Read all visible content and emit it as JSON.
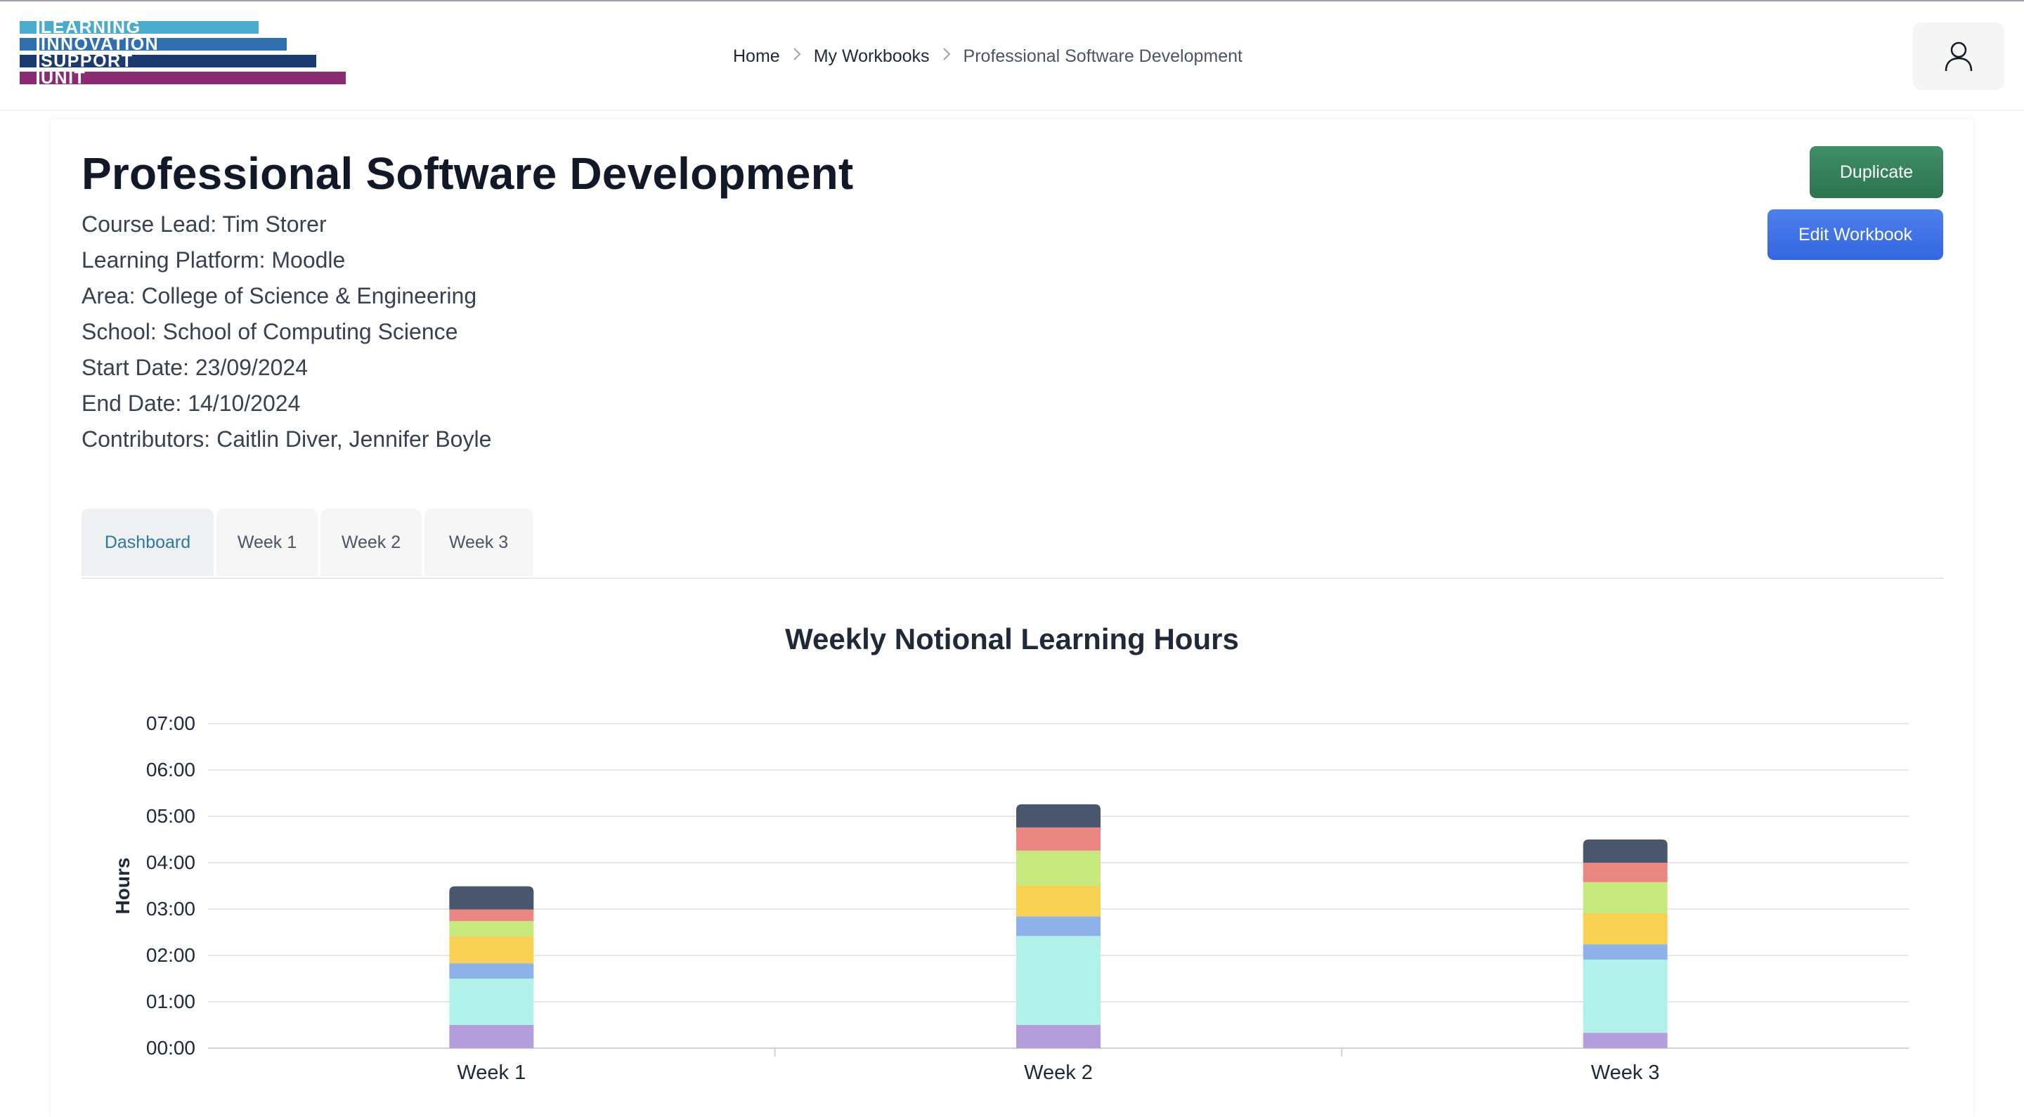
{
  "logo": {
    "lines": [
      "LEARNING",
      "INNOVATION",
      "SUPPORT",
      "UNIT"
    ],
    "colors": [
      "#4aaccc",
      "#2f6fb0",
      "#1c3a6e",
      "#8c2a72"
    ]
  },
  "breadcrumb": {
    "home": "Home",
    "workbooks": "My Workbooks",
    "current": "Professional Software Development"
  },
  "user_menu": {
    "icon": "user-icon"
  },
  "workbook": {
    "title": "Professional Software Development",
    "course_lead": "Course Lead: Tim Storer",
    "learning_platform": "Learning Platform: Moodle",
    "area": "Area: College of Science & Engineering",
    "school": "School: School of Computing Science",
    "start_date": "Start Date: 23/09/2024",
    "end_date": "End Date: 14/10/2024",
    "contributors": "Contributors: Caitlin Diver, Jennifer Boyle"
  },
  "actions": {
    "duplicate": "Duplicate",
    "edit": "Edit Workbook"
  },
  "tabs": [
    {
      "label": "Dashboard",
      "active": true
    },
    {
      "label": "Week 1",
      "active": false
    },
    {
      "label": "Week 2",
      "active": false
    },
    {
      "label": "Week 3",
      "active": false
    }
  ],
  "chart_data": {
    "type": "bar",
    "stacked": true,
    "title": "Weekly Notional Learning Hours",
    "xlabel": "",
    "ylabel": "Hours",
    "categories": [
      "Week 1",
      "Week 2",
      "Week 3"
    ],
    "ylim": [
      0,
      7
    ],
    "yticks": [
      "00:00",
      "01:00",
      "02:00",
      "03:00",
      "04:00",
      "05:00",
      "06:00",
      "07:00"
    ],
    "grid": true,
    "series": [
      {
        "color": "#b39ddb",
        "values": [
          0.5,
          0.5,
          0.33
        ]
      },
      {
        "color": "#b2f1ea",
        "values": [
          1.0,
          1.92,
          1.58
        ]
      },
      {
        "color": "#8fb1e9",
        "values": [
          0.33,
          0.42,
          0.33
        ]
      },
      {
        "color": "#f7d154",
        "values": [
          0.58,
          0.67,
          0.67
        ]
      },
      {
        "color": "#c7e77f",
        "values": [
          0.33,
          0.75,
          0.67
        ]
      },
      {
        "color": "#ea8783",
        "values": [
          0.25,
          0.5,
          0.42
        ]
      },
      {
        "color": "#4a566d",
        "values": [
          0.5,
          0.5,
          0.5
        ]
      }
    ]
  }
}
